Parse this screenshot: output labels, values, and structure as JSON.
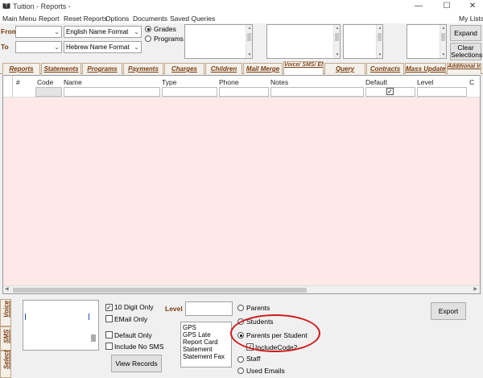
{
  "window": {
    "title": "Tuition - Reports -",
    "min": "—",
    "max": "☐",
    "close": "✕"
  },
  "menu": {
    "items": [
      "Main Menu",
      "Report",
      "Reset Reports",
      "Options",
      "Documents",
      "Saved Queries"
    ],
    "right": "My Lists"
  },
  "filter": {
    "from_label": "From",
    "to_label": "To",
    "from_value": "",
    "to_value": "",
    "name_format_1": "English Name Format",
    "name_format_2": "Hebrew Name Format",
    "mode_grades": "Grades",
    "mode_programs": "Programs",
    "selected_mode": "Grades",
    "expand_label": "Expand",
    "clear_label": "Clear Selections"
  },
  "tabs": [
    "Reports",
    "Statements",
    "Programs",
    "Payments",
    "Charges",
    "Children",
    "Mail Merge",
    "Voice/ SMS/ EMail",
    "Query",
    "Contracts",
    "Mass Update",
    "Additional Info"
  ],
  "active_tab": "Voice/ SMS/ EMail",
  "grid": {
    "columns": [
      "#",
      "Code",
      "Name",
      "Type",
      "Phone",
      "Notes",
      "Default",
      "Level",
      "C"
    ],
    "default_filter_checked": true
  },
  "bottom": {
    "side_tabs": [
      "Voice",
      "SMS",
      "Select"
    ],
    "digit_only_label": "10 Digit Only",
    "digit_only_checked": true,
    "email_only_label": "EMail Only",
    "email_only_checked": false,
    "default_only_label": "Default Only",
    "default_only_checked": false,
    "include_no_sms_label": "Include No SMS",
    "include_no_sms_checked": false,
    "view_records_label": "View Records",
    "level_label": "Level",
    "level_value": "",
    "level_options": [
      "GPS",
      "GPS Late",
      "Report Card",
      "Statement",
      "Statement Fax"
    ],
    "recipient_options": [
      "Parents",
      "Students",
      "Parents per Student",
      "Staff",
      "Used Emails"
    ],
    "selected_recipient": "Parents per Student",
    "include_code2_label": "IncludeCode2",
    "include_code2_checked": true,
    "export_label": "Export",
    "highlight_color": "#d01818"
  },
  "colors": {
    "tab_text": "#7a3d10",
    "grid_bg": "#ffe8e8"
  }
}
